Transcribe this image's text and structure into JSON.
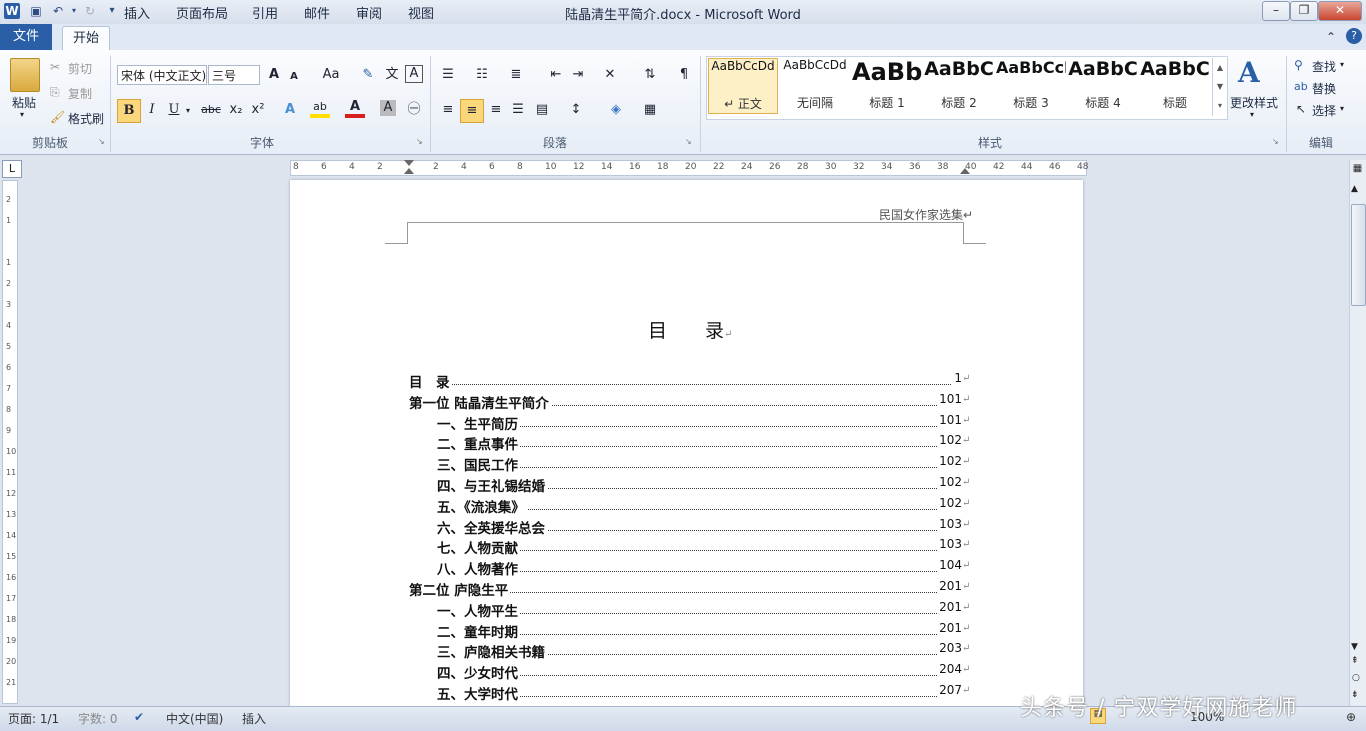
{
  "window": {
    "title": "陆晶清生平简介.docx - Microsoft Word",
    "app_icon": "W"
  },
  "tabs": {
    "file": "文件",
    "home": "开始",
    "insert": "插入",
    "layout": "页面布局",
    "references": "引用",
    "mailings": "邮件",
    "review": "审阅",
    "view": "视图"
  },
  "clipboard": {
    "paste": "粘贴",
    "cut": "剪切",
    "copy": "复制",
    "format_painter": "格式刷",
    "label": "剪贴板"
  },
  "font": {
    "font_name": "宋体 (中文正文)",
    "font_size": "三号",
    "label": "字体",
    "bold": "B",
    "italic": "I",
    "underline": "U",
    "strike": "abc",
    "subscript": "x₂",
    "superscript": "x²",
    "grow": "A",
    "shrink": "A",
    "change_case": "Aa",
    "font_color": "A",
    "highlight": "ab",
    "char_shading": "A",
    "phonetic": "文",
    "char_border": "A"
  },
  "paragraph": {
    "label": "段落"
  },
  "styles": {
    "label": "样式",
    "items": [
      {
        "sample": "AaBbCcDd",
        "name": "↵ 正文"
      },
      {
        "sample": "AaBbCcDd",
        "name": "无间隔"
      },
      {
        "sample": "AaBb",
        "name": "标题 1"
      },
      {
        "sample": "AaBbC",
        "name": "标题 2"
      },
      {
        "sample": "AaBbCcI",
        "name": "标题 3"
      },
      {
        "sample": "AaBbC",
        "name": "标题 4"
      },
      {
        "sample": "AaBbC",
        "name": "标题"
      }
    ],
    "change_styles": "更改样式"
  },
  "editing": {
    "label": "编辑",
    "find": "查找",
    "replace": "替换",
    "select": "选择"
  },
  "ruler": {
    "ticks": [
      "8",
      "6",
      "4",
      "2",
      "",
      "2",
      "4",
      "6",
      "8",
      "10",
      "12",
      "14",
      "16",
      "18",
      "20",
      "22",
      "24",
      "26",
      "28",
      "30",
      "32",
      "34",
      "36",
      "38",
      "40",
      "42",
      "44",
      "46",
      "48"
    ],
    "vticks": [
      "2",
      "1",
      "",
      "1",
      "2",
      "3",
      "4",
      "5",
      "6",
      "7",
      "8",
      "9",
      "10",
      "11",
      "12",
      "13",
      "14",
      "15",
      "16",
      "17",
      "18",
      "19",
      "20",
      "21"
    ],
    "tab_selector": "L"
  },
  "document": {
    "header": "民国女作家选集↵",
    "toc_title": "目录",
    "toc_entries": [
      {
        "text": "目　录",
        "page": "1",
        "level": 1
      },
      {
        "text": "第一位  陆晶清生平简介",
        "page": "101",
        "level": 1
      },
      {
        "text": "一、生平简历",
        "page": "101",
        "level": 2
      },
      {
        "text": "二、重点事件",
        "page": "102",
        "level": 2
      },
      {
        "text": "三、国民工作",
        "page": "102",
        "level": 2
      },
      {
        "text": "四、与王礼锡结婚",
        "page": "102",
        "level": 2
      },
      {
        "text": "五、《流浪集》",
        "page": "102",
        "level": 2
      },
      {
        "text": "六、全英援华总会",
        "page": "103",
        "level": 2
      },
      {
        "text": "七、人物贡献",
        "page": "103",
        "level": 2
      },
      {
        "text": "八、人物著作",
        "page": "104",
        "level": 2
      },
      {
        "text": "第二位  庐隐生平",
        "page": "201",
        "level": 1
      },
      {
        "text": "一、人物平生",
        "page": "201",
        "level": 2
      },
      {
        "text": "二、童年时期",
        "page": "201",
        "level": 2
      },
      {
        "text": "三、庐隐相关书籍",
        "page": "203",
        "level": 2
      },
      {
        "text": "四、少女时代",
        "page": "204",
        "level": 2
      },
      {
        "text": "五、大学时代",
        "page": "207",
        "level": 2
      }
    ]
  },
  "status": {
    "page": "页面: 1/1",
    "words": "字数: 0",
    "language": "中文(中国)",
    "mode": "插入",
    "zoom": "100%"
  },
  "watermark": "头条号 / 宁双学好网施老师"
}
